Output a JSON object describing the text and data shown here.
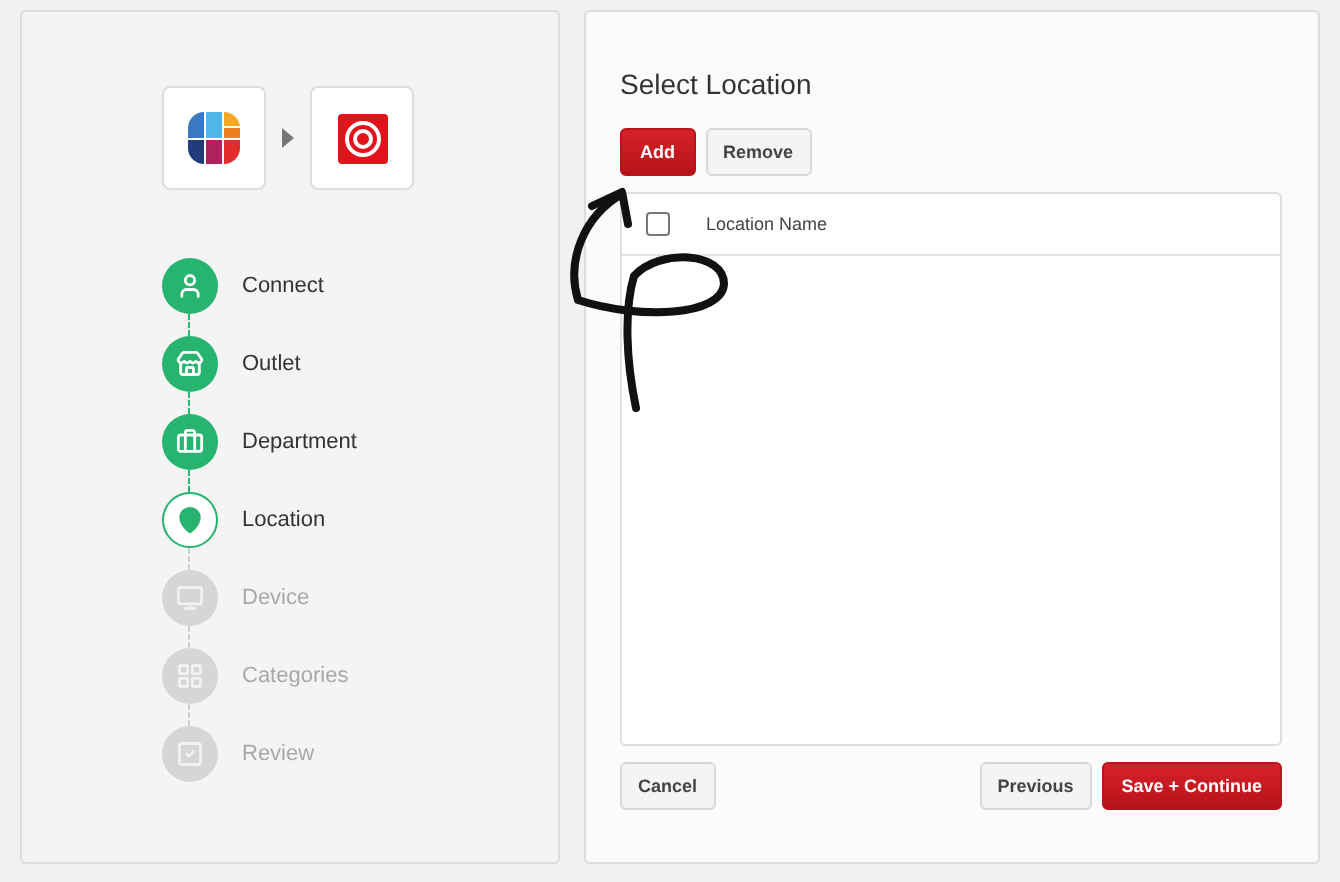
{
  "steps": [
    {
      "label": "Connect",
      "done": true,
      "selected": false
    },
    {
      "label": "Outlet",
      "done": true,
      "selected": false
    },
    {
      "label": "Department",
      "done": true,
      "selected": false
    },
    {
      "label": "Location",
      "done": false,
      "selected": true
    },
    {
      "label": "Device",
      "done": false,
      "selected": false
    },
    {
      "label": "Categories",
      "done": false,
      "selected": false
    },
    {
      "label": "Review",
      "done": false,
      "selected": false
    }
  ],
  "panel": {
    "title": "Select Location",
    "toolbar": [
      {
        "label": "Add",
        "kind": "primary"
      },
      {
        "label": "Remove",
        "kind": "secondary"
      }
    ],
    "table": {
      "select_all": {
        "checked": false
      },
      "columns": [
        "Location Name"
      ]
    },
    "footer_left": [
      {
        "label": "Cancel",
        "kind": "secondary"
      }
    ],
    "footer_right": [
      {
        "label": "Previous",
        "kind": "secondary"
      },
      {
        "label": "Save + Continue",
        "kind": "primary"
      }
    ]
  },
  "annotation": {
    "kind": "arrow"
  }
}
